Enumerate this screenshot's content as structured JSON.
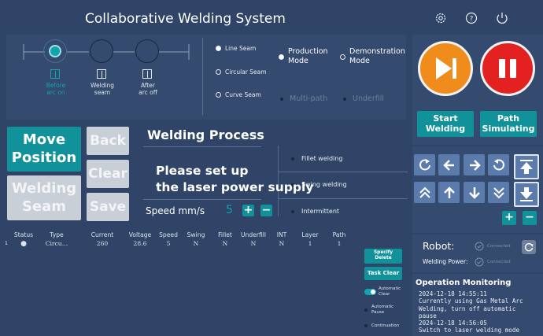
{
  "app": {
    "title": "Collaborative Welding System"
  },
  "header_icons": [
    "settings-icon",
    "help-icon",
    "power-icon"
  ],
  "stages": [
    {
      "label": "Before\narc on",
      "active": true
    },
    {
      "label": "Welding\nseam",
      "active": false
    },
    {
      "label": "After\narc off",
      "active": false
    }
  ],
  "seam_types": {
    "options": [
      "Line Seam",
      "Circular Seam",
      "Curve Seam"
    ],
    "selected": "Line Seam"
  },
  "mode": {
    "options": [
      "Production\nMode",
      "Demonstration\nMode"
    ],
    "selected": "Production\nMode"
  },
  "path_options": {
    "multi_path": "Multi-path",
    "underfill": "Underfill"
  },
  "left_buttons": {
    "move_position": "Move\nPosition",
    "welding_seam": "Welding\nSeam",
    "back": "Back",
    "clear": "Clear",
    "save": "Save"
  },
  "process": {
    "title": "Welding Process",
    "message": "Please set up\nthe laser power supply",
    "options": [
      "Fillet welding",
      "Swing welding",
      "Intermittent"
    ],
    "speed_label": "Speed mm/s",
    "speed_value": "5",
    "plus": "+",
    "minus": "−"
  },
  "table": {
    "headers": [
      "Status",
      "Type",
      "Current",
      "Voltage",
      "Speed",
      "Swing",
      "Fillet",
      "Underfill",
      "INT",
      "Layer",
      "Path"
    ],
    "rows": [
      {
        "index": "1",
        "cells": [
          "●",
          "Circu…",
          "260",
          "28.6",
          "5",
          "N",
          "N",
          "N",
          "N",
          "1",
          "1"
        ]
      }
    ]
  },
  "task_buttons": {
    "specify_delete": "Specify\nDelete",
    "task_clear": "Task Clear",
    "automatic_clear": "Automatic\nClear",
    "automatic_pause": "Automatic\nPause",
    "continuation": "Continuation"
  },
  "controls": {
    "start_welding": "Start\nWelding",
    "path_simulating": "Path\nSimulating",
    "plus": "+",
    "minus": "−"
  },
  "robot": {
    "label": "Robot:",
    "status": "Connected",
    "power_label": "Welding Power:",
    "power_status": "Connected"
  },
  "monitoring": {
    "title": "Operation Monitoring",
    "log": "2024-12-18 14:55:11\nCurrently using Gas Metal Arc\nWelding, turn off automatic\npause\n2024-12-18 14:56:05\nSwitch to laser welding mode"
  },
  "colors": {
    "background": "#2f4466",
    "panel": "#344a6e",
    "teal": "#11929a",
    "orange": "#f08c1c",
    "red": "#e32121",
    "arrow_blue": "#5a7bab"
  }
}
